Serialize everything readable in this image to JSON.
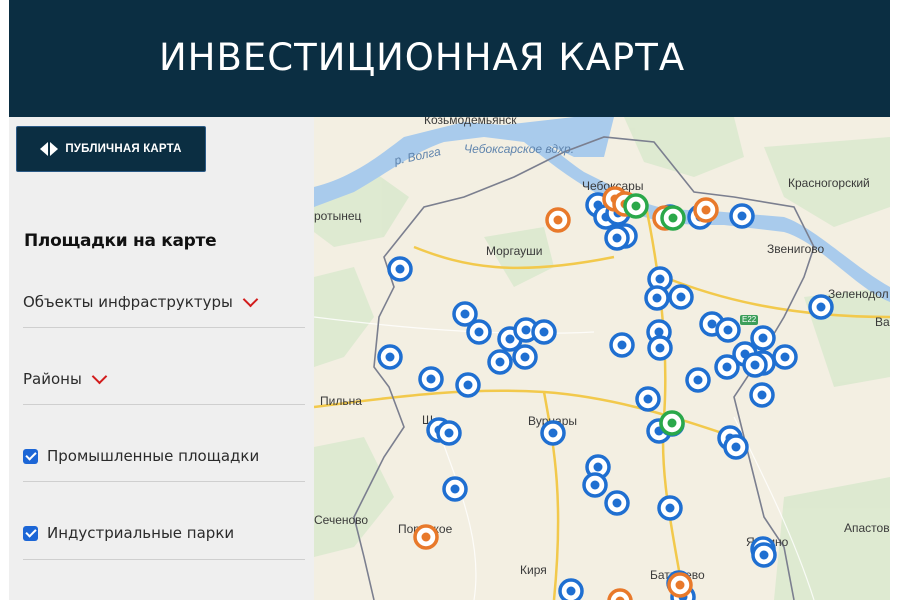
{
  "header": {
    "title": "ИНВЕСТИЦИОННАЯ КАРТА",
    "bg_color": "#0b2e42"
  },
  "sidebar": {
    "public_map_button": {
      "label": "ПУБЛИЧНАЯ КАРТА",
      "icon": "double-arrow-icon"
    },
    "section_title": "Площадки на карте",
    "dropdowns": [
      {
        "label": "Объекты инфраструктуры",
        "icon": "chevron-down-icon"
      },
      {
        "label": "Районы",
        "icon": "chevron-down-icon"
      }
    ],
    "checkboxes": [
      {
        "label": "Промышленные площадки",
        "checked": true
      },
      {
        "label": "Индустриальные парки",
        "checked": true
      }
    ]
  },
  "map": {
    "places": [
      "Козьмодемьянск",
      "р. Волга",
      "Чебоксарское вдхр.",
      "Чебоксары",
      "Красногорский",
      "ротынец",
      "Моргауши",
      "Звенигово",
      "Зеленодол",
      "Ва",
      "Пильна",
      "Вурнары",
      "Ш",
      "Сеченово",
      "Порецкое",
      "Киря",
      "Апастово",
      "Ядрино",
      "Батырево"
    ],
    "road_label": "E22",
    "marker_colors": {
      "industrial_site": "#1f6fd1",
      "industrial_park": "#e8792b",
      "special": "#2aa84a"
    }
  }
}
